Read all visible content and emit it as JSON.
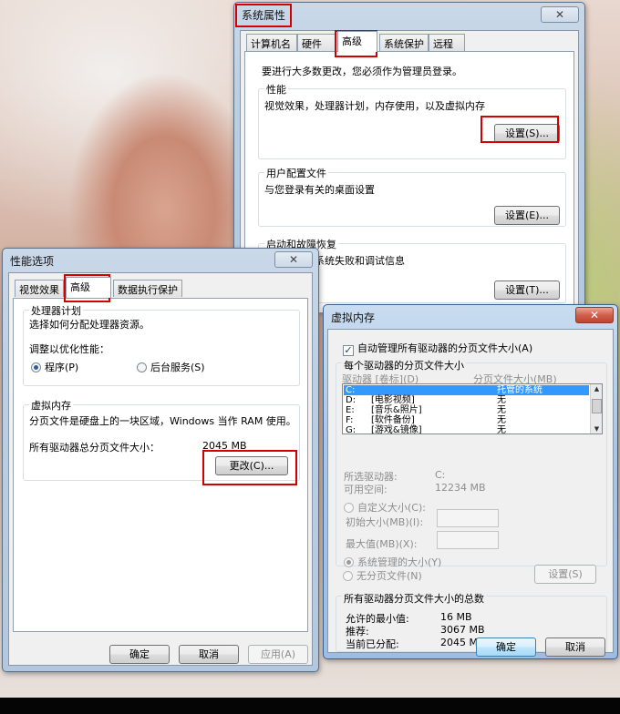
{
  "sysprops": {
    "title": "系统属性",
    "tabs": [
      "计算机名",
      "硬件",
      "高级",
      "系统保护",
      "远程"
    ],
    "admin_note": "要进行大多数更改，您必须作为管理员登录。",
    "perf": {
      "title": "性能",
      "desc": "视觉效果，处理器计划，内存使用，以及虚拟内存",
      "button": "设置(S)..."
    },
    "profile": {
      "title": "用户配置文件",
      "desc": "与您登录有关的桌面设置",
      "button": "设置(E)..."
    },
    "startup": {
      "title": "启动和故障恢复",
      "desc": "系统启动、系统失败和调试信息",
      "button": "设置(T)..."
    }
  },
  "perfopts": {
    "title": "性能选项",
    "tabs": [
      "视觉效果",
      "高级",
      "数据执行保护"
    ],
    "cpu": {
      "title": "处理器计划",
      "desc": "选择如何分配处理器资源。",
      "adjust": "调整以优化性能：",
      "opt_programs": "程序(P)",
      "opt_services": "后台服务(S)"
    },
    "vm": {
      "title": "虚拟内存",
      "desc": "分页文件是硬盘上的一块区域，Windows 当作 RAM 使用。",
      "total_label": "所有驱动器总分页文件大小：",
      "total_value": "2045 MB",
      "change": "更改(C)..."
    },
    "ok": "确定",
    "cancel": "取消",
    "apply": "应用(A)"
  },
  "vmdialog": {
    "title": "虚拟内存",
    "auto_manage": "自动管理所有驱动器的分页文件大小(A)",
    "per_drive": "每个驱动器的分页文件大小",
    "col_drive": "驱动器 [卷标](D)",
    "col_size": "分页文件大小(MB)",
    "drives": [
      {
        "drive": "C:",
        "label": "",
        "size": "托管的系统"
      },
      {
        "drive": "D:",
        "label": "[电影视频]",
        "size": "无"
      },
      {
        "drive": "E:",
        "label": "[音乐&照片]",
        "size": "无"
      },
      {
        "drive": "F:",
        "label": "[软件备份]",
        "size": "无"
      },
      {
        "drive": "G:",
        "label": "[游戏&镜像]",
        "size": "无"
      }
    ],
    "sel_drive_label": "所选驱动器:",
    "sel_drive_value": "C:",
    "free_label": "可用空间:",
    "free_value": "12234 MB",
    "custom": "自定义大小(C):",
    "initial": "初始大小(MB)(I):",
    "max": "最大值(MB)(X):",
    "system_managed": "系统管理的大小(Y)",
    "no_paging": "无分页文件(N)",
    "set": "设置(S)",
    "totals_title": "所有驱动器分页文件大小的总数",
    "min_label": "允许的最小值:",
    "min_value": "16 MB",
    "rec_label": "推荐:",
    "rec_value": "3067 MB",
    "cur_label": "当前已分配:",
    "cur_value": "2045 MB",
    "ok": "确定",
    "cancel": "取消"
  },
  "close_glyph": "✕"
}
